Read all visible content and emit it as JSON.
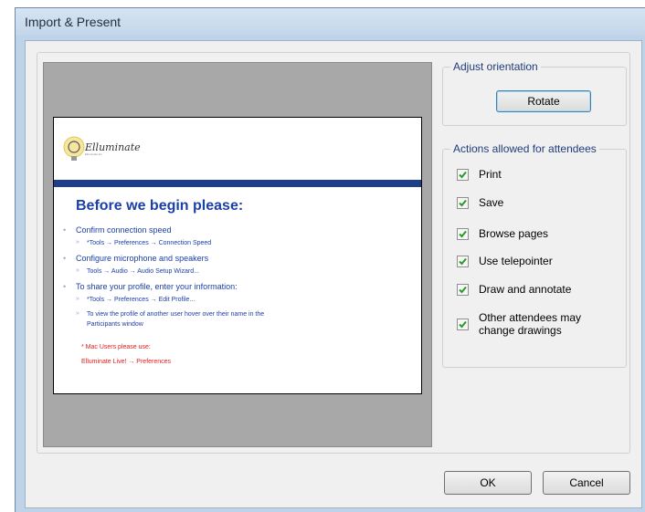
{
  "window": {
    "title": "Import & Present"
  },
  "slide": {
    "logo_text": "Elluminate",
    "logo_subtext": "Elluminate Inc.",
    "title": "Before we begin please:",
    "items": [
      {
        "level": 1,
        "text": "Confirm connection speed"
      },
      {
        "level": 2,
        "text": "*Tools → Preferences → Connection Speed"
      },
      {
        "level": 1,
        "text": "Configure microphone and speakers"
      },
      {
        "level": 2,
        "text": "Tools → Audio → Audio Setup Wizard..."
      },
      {
        "level": 1,
        "text": "To share your profile, enter your information:"
      },
      {
        "level": 2,
        "text": "*Tools → Preferences → Edit Profile..."
      },
      {
        "level": 2,
        "text": "To view the profile of another user hover over their name in the"
      },
      {
        "level": 2,
        "text": "Participants window",
        "continuation": true
      }
    ],
    "note_lines": [
      "* Mac Users please use:",
      "Elluminate Live! → Preferences"
    ]
  },
  "orientation": {
    "label": "Adjust orientation",
    "rotate_label": "Rotate"
  },
  "actions": {
    "label": "Actions allowed for attendees",
    "options": [
      {
        "label": "Print",
        "checked": true
      },
      {
        "label": "Save",
        "checked": true
      },
      {
        "label": "Browse pages",
        "checked": true
      },
      {
        "label": "Use telepointer",
        "checked": true
      },
      {
        "label": "Draw and annotate",
        "checked": true
      },
      {
        "label": "Other attendees may",
        "label2": "change drawings",
        "checked": true
      }
    ]
  },
  "buttons": {
    "ok_label": "OK",
    "cancel_label": "Cancel"
  },
  "colors": {
    "check": "#2a9a2a",
    "slide_accent": "#1c3fa8",
    "group_label": "#1f3d7a"
  }
}
